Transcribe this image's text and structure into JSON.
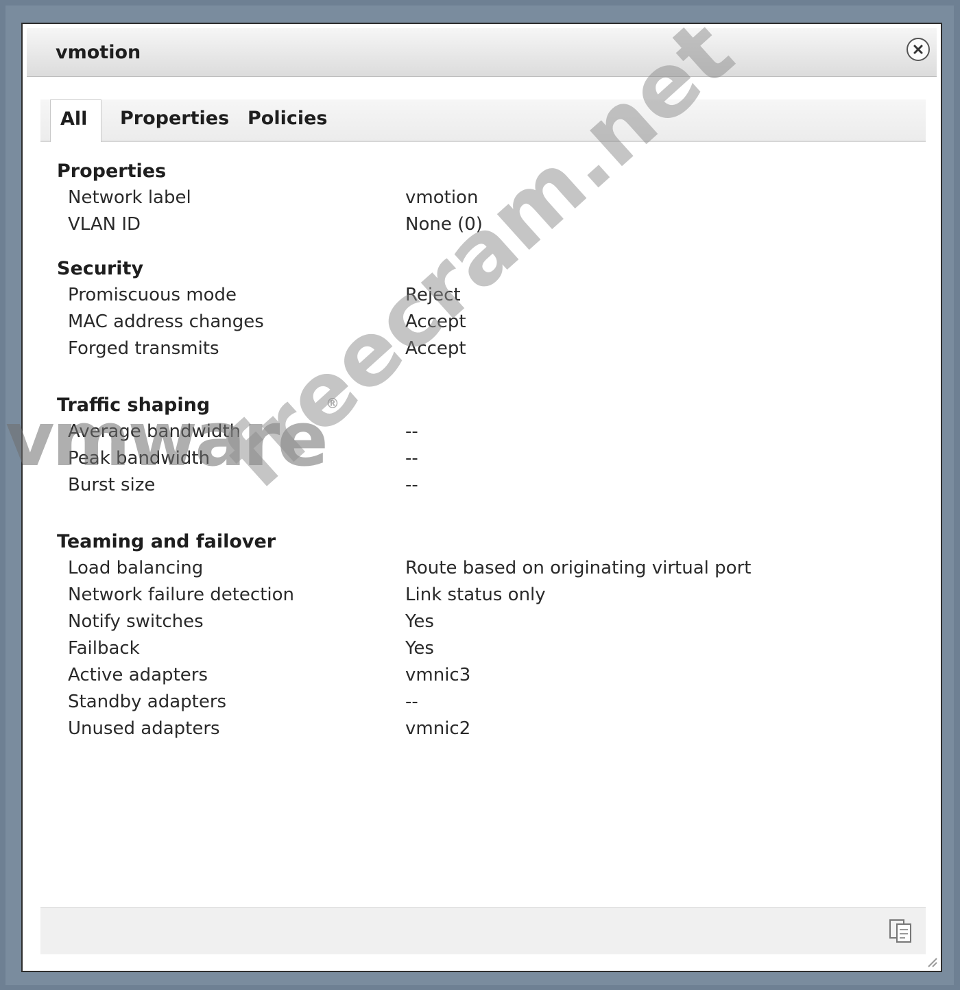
{
  "window": {
    "title": "vmotion"
  },
  "tabs": [
    {
      "label": "All",
      "active": true
    },
    {
      "label": "Properties",
      "active": false
    },
    {
      "label": "Policies",
      "active": false
    }
  ],
  "sections": {
    "properties": {
      "title": "Properties",
      "rows": [
        {
          "label": "Network label",
          "value": "vmotion"
        },
        {
          "label": "VLAN ID",
          "value": "None (0)"
        }
      ]
    },
    "security": {
      "title": "Security",
      "rows": [
        {
          "label": "Promiscuous mode",
          "value": "Reject"
        },
        {
          "label": "MAC address changes",
          "value": "Accept"
        },
        {
          "label": "Forged transmits",
          "value": "Accept"
        }
      ]
    },
    "traffic_shaping": {
      "title": "Traffic shaping",
      "rows": [
        {
          "label": "Average bandwidth",
          "value": "--"
        },
        {
          "label": "Peak bandwidth",
          "value": "--"
        },
        {
          "label": "Burst size",
          "value": "--"
        }
      ]
    },
    "teaming": {
      "title": "Teaming and failover",
      "rows": [
        {
          "label": "Load balancing",
          "value": "Route based on originating virtual port"
        },
        {
          "label": "Network failure detection",
          "value": "Link status only"
        },
        {
          "label": "Notify switches",
          "value": "Yes"
        },
        {
          "label": "Failback",
          "value": "Yes"
        },
        {
          "label": "Active adapters",
          "value": "vmnic3"
        },
        {
          "label": "Standby adapters",
          "value": "--"
        },
        {
          "label": "Unused adapters",
          "value": "vmnic2"
        }
      ]
    }
  },
  "watermarks": {
    "brand": "vmware",
    "site": "freecram.net"
  },
  "icons": {
    "close": "close-icon",
    "copy": "copy-icon",
    "grip": "resize-grip-icon"
  },
  "colors": {
    "background": "#6e8093",
    "dialog": "#ffffff",
    "text": "#1e1e1e"
  }
}
